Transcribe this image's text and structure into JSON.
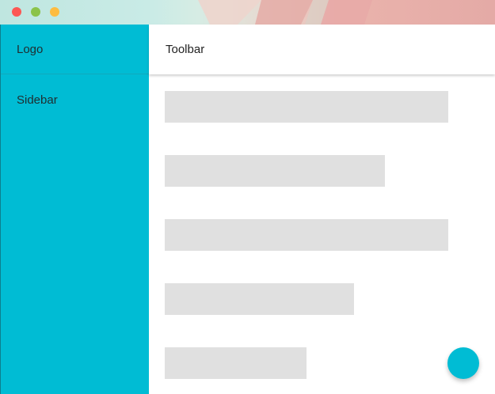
{
  "window": {
    "controls": [
      "close",
      "minimize",
      "maximize"
    ]
  },
  "sidebar": {
    "logo_label": "Logo",
    "items": [
      {
        "label": "Sidebar"
      }
    ],
    "color": "#00bcd4"
  },
  "toolbar": {
    "title": "Toolbar"
  },
  "content": {
    "placeholder_color": "#e0e0e0",
    "placeholder_count": 5
  },
  "fab": {
    "color": "#00bcd4",
    "icon": "none"
  }
}
